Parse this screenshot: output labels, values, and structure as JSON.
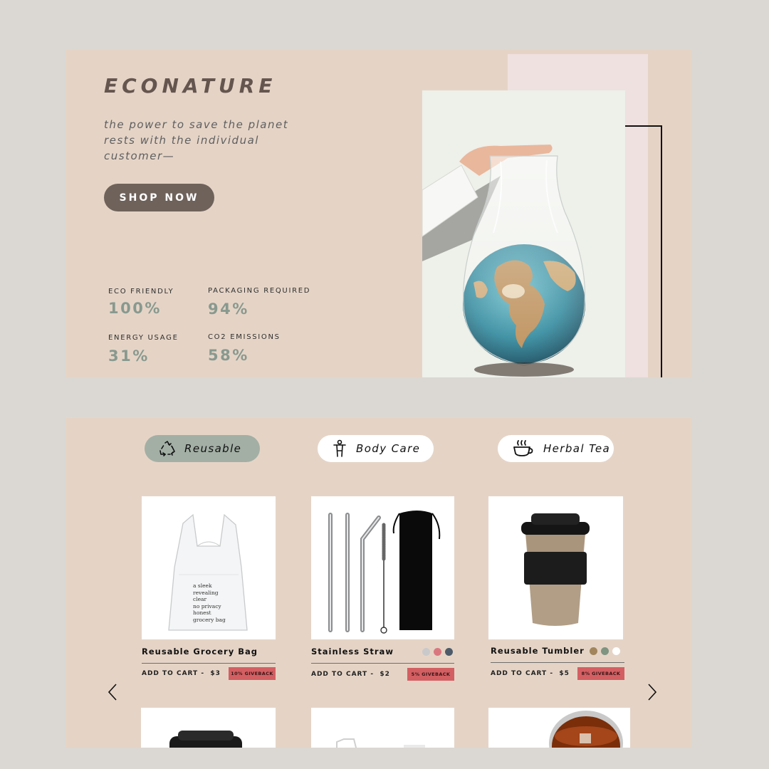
{
  "hero": {
    "brand": "ECONATURE",
    "tagline": "the power to save the planet rests with the individual customer—",
    "cta_label": "SHOP NOW",
    "stats": [
      {
        "label": "ECO FRIENDLY",
        "value": "100%"
      },
      {
        "label": "PACKAGING REQUIRED",
        "value": "94%"
      },
      {
        "label": "ENERGY USAGE",
        "value": "31%"
      },
      {
        "label": "CO2 EMISSIONS",
        "value": "58%"
      }
    ],
    "photo_icon": "globe-in-plastic-bag-photo"
  },
  "categories": [
    {
      "label": "Reusable",
      "icon": "recycle-icon",
      "active": true
    },
    {
      "label": "Body Care",
      "icon": "person-icon",
      "active": false
    },
    {
      "label": "Herbal Tea",
      "icon": "tea-cup-icon",
      "active": false
    }
  ],
  "products": [
    {
      "name": "Reusable Grocery Bag",
      "cart_label": "ADD TO CART -",
      "price": "$3",
      "giveback": "10% GIVEBACK",
      "bag_text": [
        "a sleek",
        "revealing",
        "clear",
        "no privacy",
        "honest",
        "grocery bag"
      ],
      "swatches": []
    },
    {
      "name": "Stainless Straw",
      "cart_label": "ADD TO CART -",
      "price": "$2",
      "giveback": "5% GIVEBACK",
      "swatches": [
        "#c9c9cb",
        "#d9777f",
        "#4d5a69"
      ]
    },
    {
      "name": "Reusable Tumbler",
      "cart_label": "ADD TO CART -",
      "price": "$5",
      "giveback": "8% GIVEBACK",
      "swatches": [
        "#a2855c",
        "#7f9481",
        "#ffffff"
      ]
    }
  ],
  "carousel": {
    "prev_icon": "chevron-left-icon",
    "next_icon": "chevron-right-icon"
  },
  "colors": {
    "accent": "#6e625b",
    "sage": "#a3afa5",
    "badge": "#d35f63",
    "panel": "#e5d4c6",
    "background": "#dbd8d3"
  }
}
